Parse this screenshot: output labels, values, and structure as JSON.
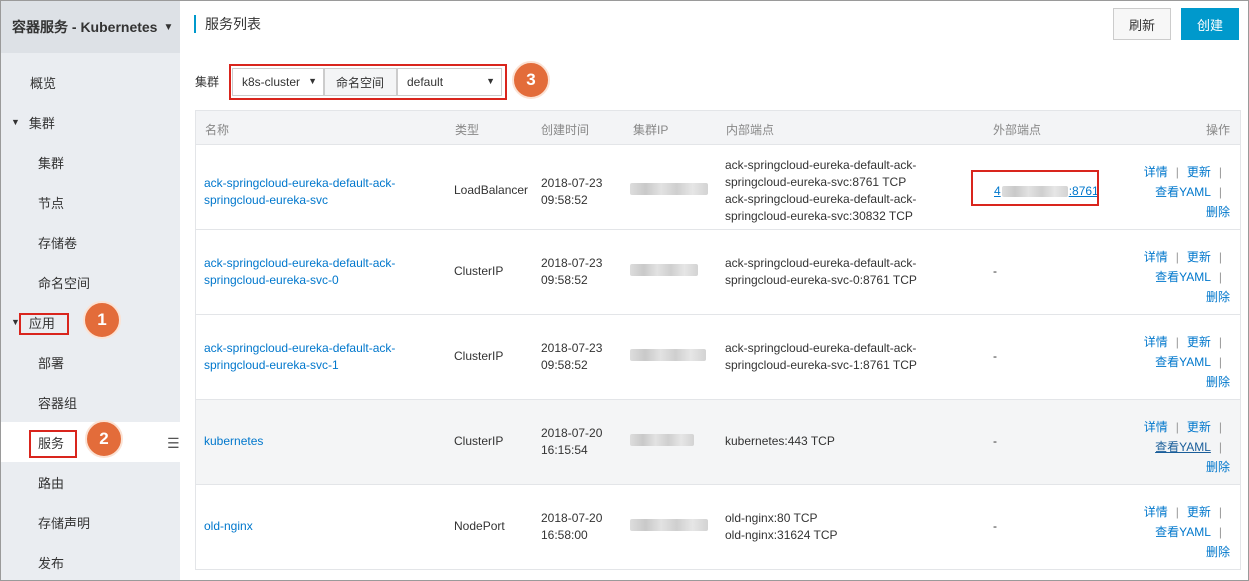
{
  "sidebar": {
    "header": "容器服务 - Kubernetes",
    "items": [
      {
        "label": "概览"
      },
      {
        "label": "集群"
      },
      {
        "label": "集群"
      },
      {
        "label": "节点"
      },
      {
        "label": "存储卷"
      },
      {
        "label": "命名空间"
      },
      {
        "label": "应用"
      },
      {
        "label": "部署"
      },
      {
        "label": "容器组"
      },
      {
        "label": "服务"
      },
      {
        "label": "路由"
      },
      {
        "label": "存储声明"
      },
      {
        "label": "发布"
      }
    ]
  },
  "header": {
    "title": "服务列表",
    "refresh_label": "刷新",
    "create_label": "创建"
  },
  "filters": {
    "cluster_label": "集群",
    "cluster_value": "k8s-cluster",
    "namespace_label": "命名空间",
    "namespace_value": "default"
  },
  "badges": {
    "b1": "1",
    "b2": "2",
    "b3": "3"
  },
  "table": {
    "columns": [
      "名称",
      "类型",
      "创建时间",
      "集群IP",
      "内部端点",
      "外部端点",
      "操作"
    ],
    "rows": [
      {
        "name_line1": "ack-springcloud-eureka-default-ack-",
        "name_line2": "springcloud-eureka-svc",
        "type": "LoadBalancer",
        "date": "2018-07-23",
        "time": "09:58:52",
        "internal": [
          "ack-springcloud-eureka-default-ack-",
          "springcloud-eureka-svc:8761 TCP",
          "ack-springcloud-eureka-default-ack-",
          "springcloud-eureka-svc:30832 TCP"
        ],
        "external_prefix": "4",
        "external_port": ":8761"
      },
      {
        "name_line1": "ack-springcloud-eureka-default-ack-",
        "name_line2": "springcloud-eureka-svc-0",
        "type": "ClusterIP",
        "date": "2018-07-23",
        "time": "09:58:52",
        "internal": [
          "ack-springcloud-eureka-default-ack-",
          "springcloud-eureka-svc-0:8761 TCP"
        ],
        "external": "-"
      },
      {
        "name_line1": "ack-springcloud-eureka-default-ack-",
        "name_line2": "springcloud-eureka-svc-1",
        "type": "ClusterIP",
        "date": "2018-07-23",
        "time": "09:58:52",
        "internal": [
          "ack-springcloud-eureka-default-ack-",
          "springcloud-eureka-svc-1:8761 TCP"
        ],
        "external": "-"
      },
      {
        "name_line1": "kubernetes",
        "type": "ClusterIP",
        "date": "2018-07-20",
        "time": "16:15:54",
        "internal": [
          "kubernetes:443 TCP"
        ],
        "external": "-"
      },
      {
        "name_line1": "old-nginx",
        "type": "NodePort",
        "date": "2018-07-20",
        "time": "16:58:00",
        "internal": [
          "old-nginx:80 TCP",
          "old-nginx:31624 TCP"
        ],
        "external": "-"
      }
    ],
    "ops": {
      "detail": "详情",
      "update": "更新",
      "yaml": "查看YAML",
      "delete": "删除",
      "sep": "|"
    }
  }
}
